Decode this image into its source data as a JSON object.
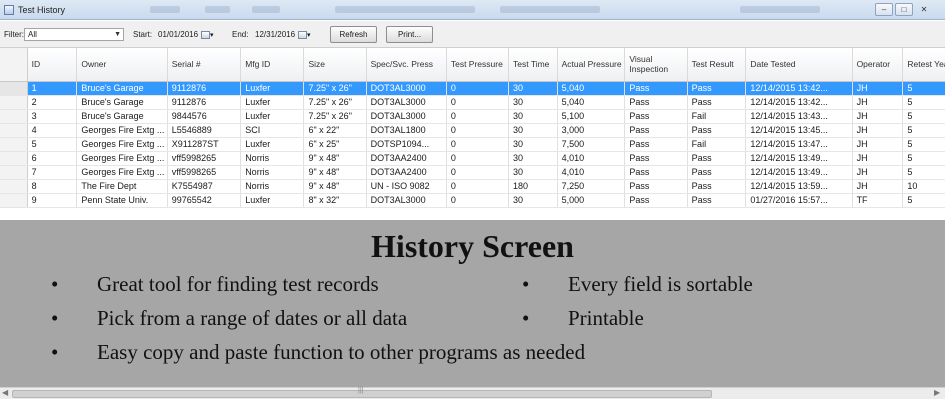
{
  "window": {
    "title": "Test History"
  },
  "toolbar": {
    "filter_label": "Filter:",
    "filter_value": "All",
    "start_label": "Start:",
    "start_date": "01/01/2016",
    "end_label": "End:",
    "end_date": "12/31/2016",
    "refresh_label": "Refresh",
    "print_label": "Print..."
  },
  "grid": {
    "columns": [
      "ID",
      "Owner",
      "Serial #",
      "Mfg ID",
      "Size",
      "Spec/Svc. Press",
      "Test Pressure",
      "Test Time",
      "Actual Pressure",
      "Visual Inspection",
      "Test Result",
      "Date Tested",
      "Operator",
      "Retest Years"
    ],
    "selected_row": 0,
    "rows": [
      [
        "1",
        "Bruce's Garage",
        "9112876",
        "Luxfer",
        "7.25\" x 26\"",
        "DOT3AL3000",
        "0",
        "30",
        "5,040",
        "Pass",
        "Pass",
        "12/14/2015 13:42...",
        "JH",
        "5"
      ],
      [
        "2",
        "Bruce's Garage",
        "9112876",
        "Luxfer",
        "7.25\" x 26\"",
        "DOT3AL3000",
        "0",
        "30",
        "5,040",
        "Pass",
        "Pass",
        "12/14/2015 13:42...",
        "JH",
        "5"
      ],
      [
        "3",
        "Bruce's Garage",
        "9844576",
        "Luxfer",
        "7.25\" x 26\"",
        "DOT3AL3000",
        "0",
        "30",
        "5,100",
        "Pass",
        "Fail",
        "12/14/2015 13:43...",
        "JH",
        "5"
      ],
      [
        "4",
        "Georges Fire Extg ...",
        "L5546889",
        "SCI",
        "6\" x 22\"",
        "DOT3AL1800",
        "0",
        "30",
        "3,000",
        "Pass",
        "Pass",
        "12/14/2015 13:45...",
        "JH",
        "5"
      ],
      [
        "5",
        "Georges Fire Extg ...",
        "X911287ST",
        "Luxfer",
        "6\" x 25\"",
        "DOTSP1094...",
        "0",
        "30",
        "7,500",
        "Pass",
        "Fail",
        "12/14/2015 13:47...",
        "JH",
        "5"
      ],
      [
        "6",
        "Georges Fire Extg ...",
        "vff5998265",
        "Norris",
        "9\" x 48\"",
        "DOT3AA2400",
        "0",
        "30",
        "4,010",
        "Pass",
        "Pass",
        "12/14/2015 13:49...",
        "JH",
        "5"
      ],
      [
        "7",
        "Georges Fire Extg ...",
        "vff5998265",
        "Norris",
        "9\" x 48\"",
        "DOT3AA2400",
        "0",
        "30",
        "4,010",
        "Pass",
        "Pass",
        "12/14/2015 13:49...",
        "JH",
        "5"
      ],
      [
        "8",
        "The Fire Dept",
        "K7554987",
        "Norris",
        "9\" x 48\"",
        "UN - ISO 9082",
        "0",
        "180",
        "7,250",
        "Pass",
        "Pass",
        "12/14/2015 13:59...",
        "JH",
        "10"
      ],
      [
        "9",
        "Penn State Univ.",
        "99765542",
        "Luxfer",
        "8\" x 32\"",
        "DOT3AL3000",
        "0",
        "30",
        "5,000",
        "Pass",
        "Pass",
        "01/27/2016 15:57...",
        "TF",
        "5"
      ]
    ]
  },
  "slide": {
    "title": "History Screen",
    "bullet_glyph": "•",
    "bullets": [
      "Great tool for finding test records",
      "Every field is sortable",
      "Pick from a range of dates or all data",
      "Printable",
      "Easy copy and paste function to other programs as needed"
    ]
  },
  "colors": {
    "selection": "#3399ff",
    "overlay": "#a6a6a6"
  }
}
